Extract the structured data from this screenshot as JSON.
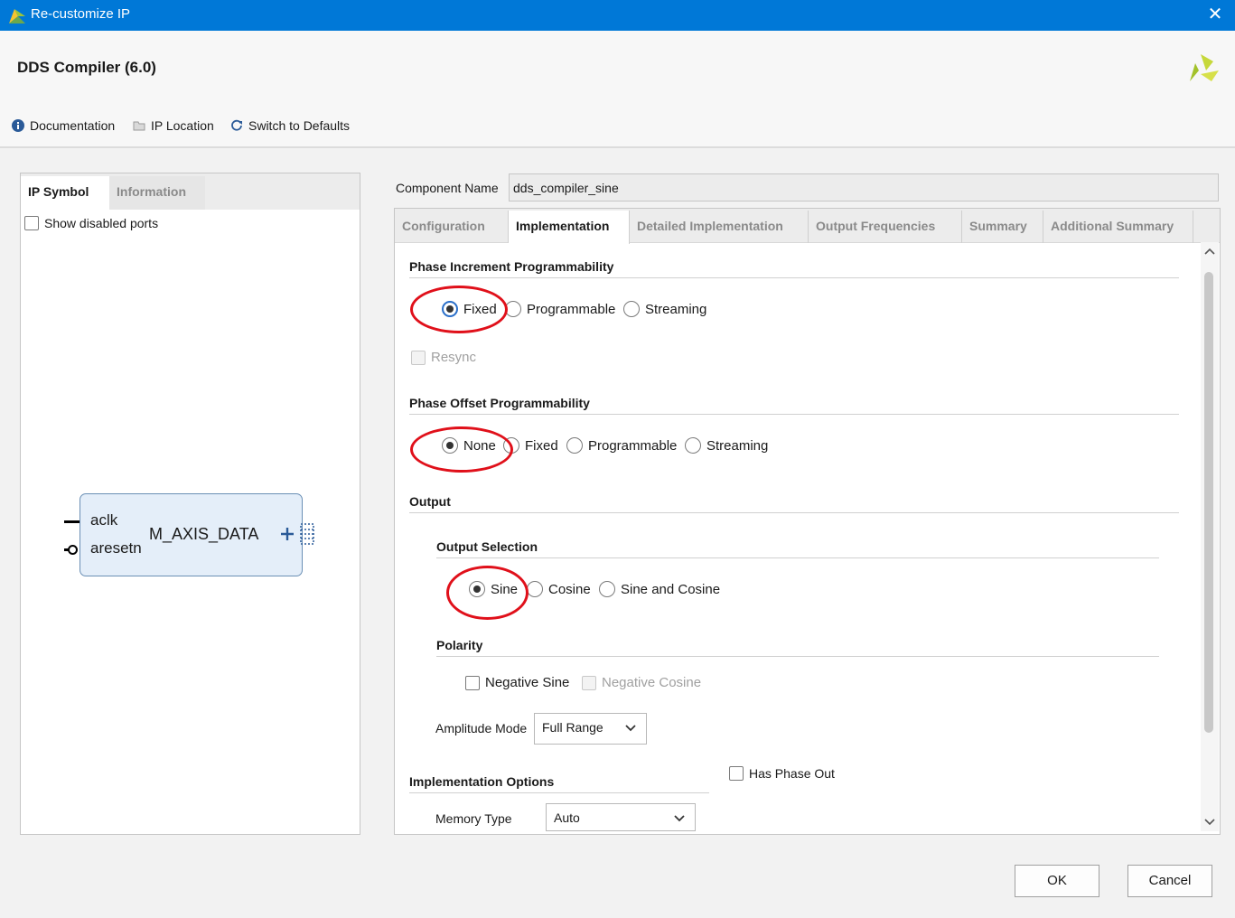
{
  "window": {
    "title": "Re-customize IP"
  },
  "header": {
    "ip_title": "DDS Compiler (6.0)",
    "tools": {
      "documentation": "Documentation",
      "ip_location": "IP Location",
      "switch_defaults": "Switch to Defaults"
    }
  },
  "left": {
    "tabs": [
      "IP Symbol",
      "Information"
    ],
    "show_disabled_ports": "Show disabled ports",
    "symbol": {
      "ports_in": [
        "aclk",
        "aresetn"
      ],
      "port_out": "M_AXIS_DATA"
    }
  },
  "component": {
    "label": "Component Name",
    "value": "dds_compiler_sine"
  },
  "tabs": [
    "Configuration",
    "Implementation",
    "Detailed Implementation",
    "Output Frequencies",
    "Summary",
    "Additional Summary"
  ],
  "impl": {
    "phase_inc": {
      "title": "Phase Increment Programmability",
      "options": [
        "Fixed",
        "Programmable",
        "Streaming"
      ],
      "selected": "Fixed",
      "resync": "Resync"
    },
    "phase_off": {
      "title": "Phase Offset Programmability",
      "options": [
        "None",
        "Fixed",
        "Programmable",
        "Streaming"
      ],
      "selected": "None"
    },
    "output": {
      "title": "Output",
      "selection_title": "Output Selection",
      "selection_options": [
        "Sine",
        "Cosine",
        "Sine and Cosine"
      ],
      "selected": "Sine",
      "polarity_title": "Polarity",
      "negative_sine": "Negative Sine",
      "negative_cosine": "Negative Cosine",
      "amplitude_label": "Amplitude Mode",
      "amplitude_value": "Full Range"
    },
    "impl_options": {
      "title": "Implementation Options",
      "has_phase_out": "Has Phase Out",
      "memory_label": "Memory Type",
      "memory_value": "Auto"
    }
  },
  "buttons": {
    "ok": "OK",
    "cancel": "Cancel"
  },
  "colors": {
    "titlebar": "#0078d7",
    "highlight_circle": "#e0101a",
    "logo": "#a3c22b"
  }
}
